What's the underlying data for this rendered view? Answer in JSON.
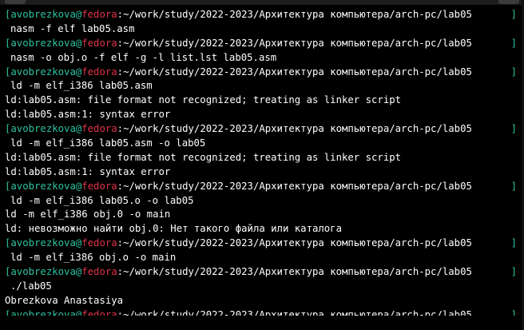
{
  "prompt": {
    "user": "avobrezkova",
    "at": "@",
    "host": "fedora",
    "path": ":~/work/study/2022-2023/Архитектура компьютера/arch-pc/lab05",
    "open": "[",
    "close": "]"
  },
  "lines": [
    {
      "type": "prompt"
    },
    {
      "type": "cmd",
      "text": "nasm -f elf lab05.asm"
    },
    {
      "type": "prompt"
    },
    {
      "type": "cmd",
      "text": "nasm -o obj.o -f elf -g -l list.lst lab05.asm"
    },
    {
      "type": "prompt"
    },
    {
      "type": "cmd",
      "text": "ld -m elf_i386 lab05.asm"
    },
    {
      "type": "out",
      "text": "ld:lab05.asm: file format not recognized; treating as linker script"
    },
    {
      "type": "out",
      "text": "ld:lab05.asm:1: syntax error"
    },
    {
      "type": "prompt"
    },
    {
      "type": "cmd",
      "text": "ld -m elf_i386 lab05.asm -o lab05"
    },
    {
      "type": "out",
      "text": "ld:lab05.asm: file format not recognized; treating as linker script"
    },
    {
      "type": "out",
      "text": "ld:lab05.asm:1: syntax error"
    },
    {
      "type": "prompt"
    },
    {
      "type": "cmd",
      "text": "ld -m elf_i386 lab05.o -o lab05"
    },
    {
      "type": "out",
      "text": "ld -m elf_i386 obj.0 -o main"
    },
    {
      "type": "out",
      "text": "ld: невозможно найти obj.0: Нет такого файла или каталога"
    },
    {
      "type": "prompt"
    },
    {
      "type": "cmd",
      "text": "ld -m elf_i386 obj.o -o main"
    },
    {
      "type": "prompt"
    },
    {
      "type": "cmd",
      "text": "./lab05"
    },
    {
      "type": "out",
      "text": "Obrezkova Anastasiya"
    },
    {
      "type": "prompt",
      "clipped": true
    }
  ],
  "colors": {
    "background": "#000000",
    "prompt": "#2ec29e",
    "host": "#e0324a",
    "text": "#ffffff"
  }
}
